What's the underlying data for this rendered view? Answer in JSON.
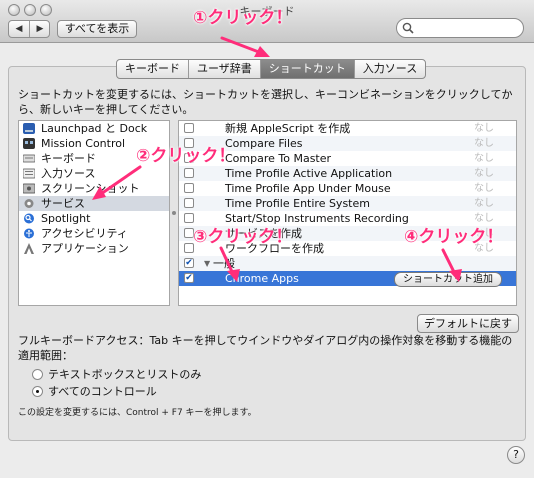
{
  "window": {
    "title": "キーボード"
  },
  "toolbar": {
    "back": "◀",
    "forward": "▶",
    "show_all": "すべてを表示",
    "search_placeholder": ""
  },
  "tabs": [
    {
      "label": "キーボード",
      "active": false
    },
    {
      "label": "ユーザ辞書",
      "active": false
    },
    {
      "label": "ショートカット",
      "active": true
    },
    {
      "label": "入力ソース",
      "active": false
    }
  ],
  "instructions": "ショートカットを変更するには、ショートカットを選択し、キーコンビネーションをクリックしてから、新しいキーを押してください。",
  "left_list": [
    {
      "label": "Launchpad と Dock",
      "icon": "launchpad-icon"
    },
    {
      "label": "Mission Control",
      "icon": "mission-control-icon"
    },
    {
      "label": "キーボード",
      "icon": "keyboard-icon"
    },
    {
      "label": "入力ソース",
      "icon": "input-source-icon"
    },
    {
      "label": "スクリーンショット",
      "icon": "screenshot-icon"
    },
    {
      "label": "サービス",
      "icon": "gear-icon",
      "selected": true
    },
    {
      "label": "Spotlight",
      "icon": "spotlight-icon"
    },
    {
      "label": "アクセシビリティ",
      "icon": "accessibility-icon"
    },
    {
      "label": "アプリケーション",
      "icon": "app-icon"
    }
  ],
  "right_list": [
    {
      "label": "新規 AppleScript を作成",
      "shortcut": "なし",
      "checked": false
    },
    {
      "label": "Compare Files",
      "shortcut": "なし",
      "checked": false
    },
    {
      "label": "Compare To Master",
      "shortcut": "なし",
      "checked": false
    },
    {
      "label": "Time Profile Active Application",
      "shortcut": "なし",
      "checked": false
    },
    {
      "label": "Time Profile App Under Mouse",
      "shortcut": "なし",
      "checked": false
    },
    {
      "label": "Time Profile Entire System",
      "shortcut": "なし",
      "checked": false
    },
    {
      "label": "Start/Stop Instruments Recording",
      "shortcut": "なし",
      "checked": false
    },
    {
      "label": "サービスを作成",
      "shortcut": "なし",
      "checked": false
    },
    {
      "label": "ワークフローを作成",
      "shortcut": "なし",
      "checked": false
    },
    {
      "label": "一般",
      "shortcut": "",
      "checked": true,
      "group": true
    },
    {
      "label": "Chrome Apps",
      "shortcut": "",
      "checked": true,
      "selected": true
    }
  ],
  "add_shortcut_label": "ショートカット追加",
  "defaults_button": "デフォルトに戻す",
  "full_keyboard_access": "フルキーボードアクセス：Tab キーを押してウインドウやダイアログ内の操作対象を移動する機能の適用範囲：",
  "radio_options": [
    {
      "label": "テキストボックスとリストのみ",
      "selected": false
    },
    {
      "label": "すべてのコントロール",
      "selected": true
    }
  ],
  "note": "この設定を変更するには、Control + F7 キーを押します。",
  "help_label": "?",
  "annotations": [
    "①クリック！",
    "②クリック！",
    "③クリック！",
    "④クリック！"
  ],
  "colors": {
    "annotation": "#ff2d7a",
    "selection": "#3875d7"
  }
}
